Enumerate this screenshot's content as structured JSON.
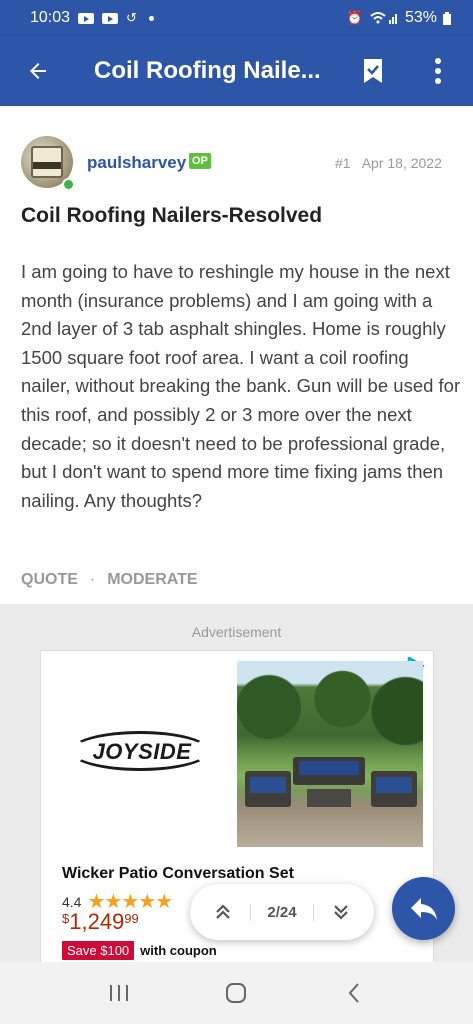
{
  "status_bar": {
    "time": "10:03",
    "battery": "53%"
  },
  "app_bar": {
    "title": "Coil Roofing Naile..."
  },
  "post": {
    "username": "paulsharvey",
    "op_badge": "OP",
    "number": "#1",
    "date": "Apr 18, 2022",
    "title": "Coil Roofing Nailers-Resolved",
    "body": "I am going to have to reshingle my house in the next month (insurance problems) and I am going with a 2nd layer of 3 tab asphalt shingles. Home is roughly 1500 square foot roof area. I want a coil roofing nailer, without breaking the bank. Gun will be used for this roof, and possibly 2 or 3 more over the next decade; so it doesn't need to be professional grade, but I don't want to spend more time fixing jams then nailing. Any thoughts?",
    "actions": {
      "quote": "QUOTE",
      "moderate": "MODERATE"
    }
  },
  "ad": {
    "label": "Advertisement",
    "brand": "JOYSIDE",
    "product_name": "Wicker Patio Conversation Set",
    "rating": "4.4",
    "stars": "★★★★★",
    "price_symbol": "$",
    "price_main": "1,249",
    "price_cents": "99",
    "save_badge": "Save $100",
    "coupon_text": "with coupon"
  },
  "pager": {
    "count": "2/24"
  },
  "colors": {
    "primary": "#2e56a8",
    "op_badge": "#5fbf3f",
    "price": "#b12704",
    "save_badge": "#cc0c39"
  }
}
